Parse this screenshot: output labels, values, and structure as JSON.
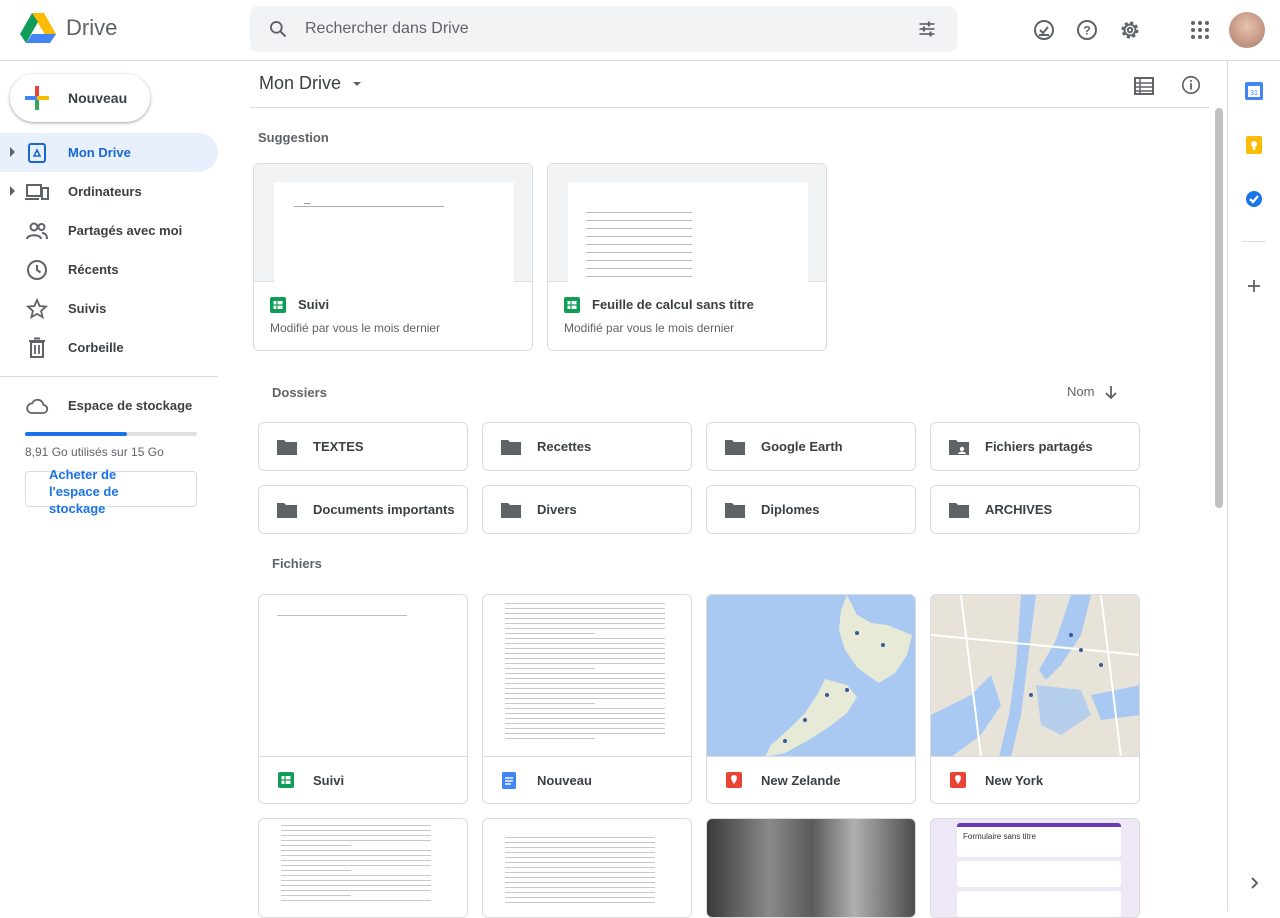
{
  "app": {
    "name": "Drive"
  },
  "search": {
    "placeholder": "Rechercher dans Drive"
  },
  "header": {
    "icons": [
      "offline-check-icon",
      "help-icon",
      "settings-icon",
      "apps-grid-icon"
    ]
  },
  "new_button": {
    "label": "Nouveau"
  },
  "sidebar": {
    "items": [
      {
        "label": "Mon Drive",
        "icon": "my-drive-icon",
        "active": true,
        "expandable": true
      },
      {
        "label": "Ordinateurs",
        "icon": "computers-icon",
        "expandable": true
      },
      {
        "label": "Partagés avec moi",
        "icon": "shared-icon"
      },
      {
        "label": "Récents",
        "icon": "clock-icon"
      },
      {
        "label": "Suivis",
        "icon": "star-icon"
      },
      {
        "label": "Corbeille",
        "icon": "trash-icon"
      }
    ],
    "storage": {
      "label": "Espace de stockage",
      "usage_text": "8,91 Go utilisés sur 15 Go",
      "used_fraction": 0.594,
      "buy_label": "Acheter de l'espace de stockage"
    }
  },
  "main": {
    "title": "Mon Drive",
    "suggestion_label": "Suggestion",
    "suggestions": [
      {
        "name": "Suivi",
        "meta": "Modifié par vous le mois dernier"
      },
      {
        "name": "Feuille de calcul sans titre",
        "meta": "Modifié par vous le mois dernier"
      }
    ],
    "folders_label": "Dossiers",
    "sort_label": "Nom",
    "folders": [
      {
        "name": "TEXTES",
        "shared": false
      },
      {
        "name": "Recettes",
        "shared": false
      },
      {
        "name": "Google Earth",
        "shared": false
      },
      {
        "name": "Fichiers partagés",
        "shared": true
      },
      {
        "name": "Documents importants",
        "shared": false
      },
      {
        "name": "Divers",
        "shared": false
      },
      {
        "name": "Diplomes",
        "shared": false
      },
      {
        "name": "ARCHIVES",
        "shared": false
      }
    ],
    "files_label": "Fichiers",
    "files": [
      {
        "name": "Suivi",
        "type": "sheets"
      },
      {
        "name": "Nouveau",
        "type": "docs"
      },
      {
        "name": "New Zelande",
        "type": "maps"
      },
      {
        "name": "New York",
        "type": "maps"
      }
    ],
    "form_preview": {
      "title": "Formulaire sans titre"
    }
  },
  "colors": {
    "accent": "#1a73e8",
    "active_bg": "#e8f0fe",
    "sheets": "#0f9d58",
    "docs": "#4285f4",
    "maps": "#ea4335",
    "forms": "#673ab7"
  }
}
